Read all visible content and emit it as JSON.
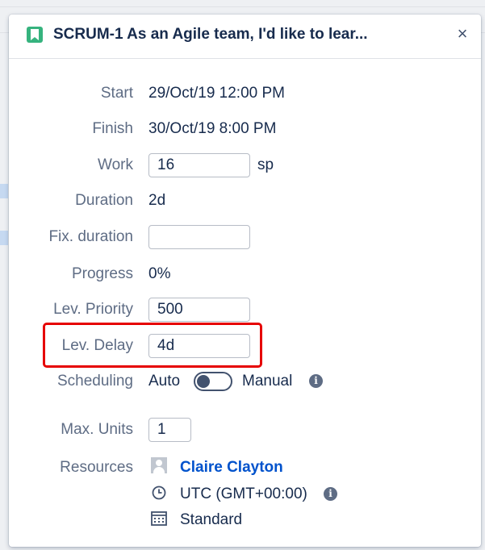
{
  "issue": {
    "key_title": "SCRUM-1 As an Agile team, I'd like to lear...",
    "type_icon": "story-bookmark-icon",
    "type_color": "#36b37e"
  },
  "close_icon": "×",
  "fields": {
    "start": {
      "label": "Start",
      "value": "29/Oct/19 12:00 PM"
    },
    "finish": {
      "label": "Finish",
      "value": "30/Oct/19 8:00 PM"
    },
    "work": {
      "label": "Work",
      "value": "16",
      "unit": "sp"
    },
    "duration": {
      "label": "Duration",
      "value": "2d"
    },
    "fix_duration": {
      "label": "Fix. duration",
      "value": ""
    },
    "progress": {
      "label": "Progress",
      "value": "0%"
    },
    "lev_priority": {
      "label": "Lev. Priority",
      "value": "500"
    },
    "lev_delay": {
      "label": "Lev. Delay",
      "value": "4d"
    },
    "scheduling": {
      "label": "Scheduling",
      "auto": "Auto",
      "manual": "Manual",
      "mode": "auto"
    },
    "max_units": {
      "label": "Max. Units",
      "value": "1"
    },
    "resources": {
      "label": "Resources",
      "name": "Claire Clayton",
      "timezone": "UTC (GMT+00:00)",
      "calendar": "Standard"
    }
  },
  "info_glyph": "i",
  "colors": {
    "link": "#0052cc",
    "highlight": "#e60000",
    "label": "#5e6c84"
  }
}
